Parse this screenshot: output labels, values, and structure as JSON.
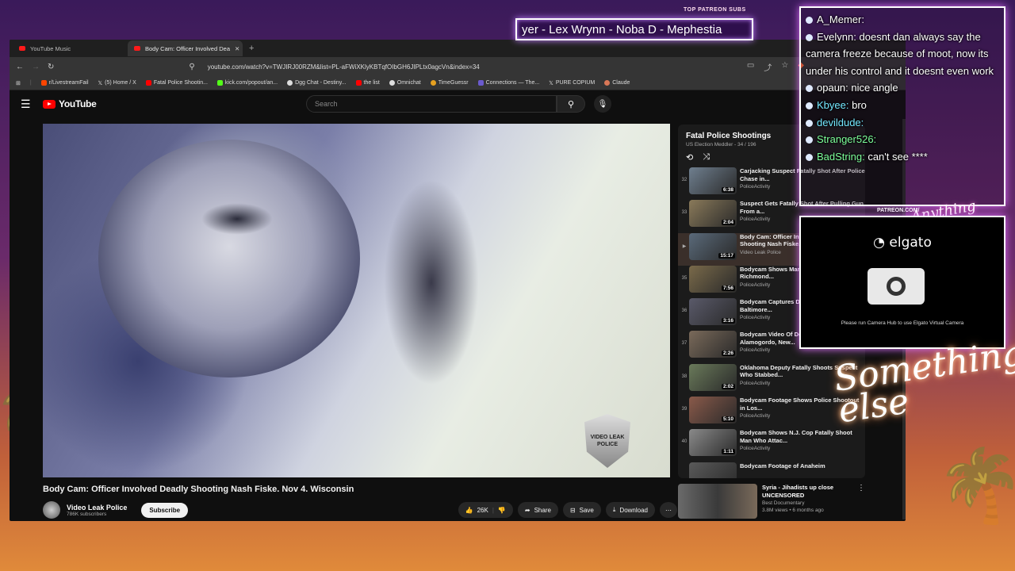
{
  "browser": {
    "tabs": [
      {
        "label": "YouTube Music",
        "active": false
      },
      {
        "label": "Body Cam: Officer Involved Dea",
        "active": true
      }
    ],
    "url": "youtube.com/watch?v=TWJIRJ00RZM&list=PL-aFWiXKlyKBTqfOIbGH6JIPLtx0agcVn&index=34",
    "bookmarks": [
      "r/LivestreamFail",
      "(5) Home / X",
      "Fatal Police Shootin...",
      "kick.com/popout/an...",
      "Dgg Chat - Destiny...",
      "the list",
      "Omnichat",
      "TimeGuessr",
      "Connections — The...",
      "PURE COPIUM",
      "Claude"
    ]
  },
  "youtube": {
    "logo": "YouTube",
    "search_placeholder": "Search",
    "video_title": "Body Cam: Officer Involved Deadly Shooting Nash Fiske. Nov 4. Wisconsin",
    "watermark": "VIDEO LEAK POLICE",
    "channel": {
      "name": "Video Leak Police",
      "subscribers": "786K subscribers"
    },
    "subscribe_label": "Subscribe",
    "actions": {
      "likes": "26K",
      "share": "Share",
      "save": "Save",
      "download": "Download"
    },
    "playlist": {
      "title": "Fatal Police Shootings",
      "subtitle": "US Election Meddler - 34 / 196",
      "items": [
        {
          "num": "32",
          "title": "Carjacking Suspect Fatally Shot After Police Chase in...",
          "channel": "PoliceActivity",
          "duration": "6:38",
          "color": "#6f7f8f"
        },
        {
          "num": "33",
          "title": "Suspect Gets Fatally Shot After Pulling Gun From a...",
          "channel": "PoliceActivity",
          "duration": "2:04",
          "color": "#8a7a5a"
        },
        {
          "num": "▶",
          "title": "Body Cam: Officer Involved Deadly Shooting Nash Fiske...",
          "channel": "Video Leak Police",
          "duration": "15:17",
          "color": "#5a6a7a"
        },
        {
          "num": "35",
          "title": "Bodycam Shows Man Being Fatally Shot by Richmond...",
          "channel": "PoliceActivity",
          "duration": "7:56",
          "color": "#7a6a4a"
        },
        {
          "num": "36",
          "title": "Bodycam Captures Deadly Shootout in Baltimore...",
          "channel": "PoliceActivity",
          "duration": "3:16",
          "color": "#5a5a6a"
        },
        {
          "num": "37",
          "title": "Bodycam Video Of Deadly Shootout in Alamogordo, New...",
          "channel": "PoliceActivity",
          "duration": "2:26",
          "color": "#7a6a5a"
        },
        {
          "num": "38",
          "title": "Oklahoma Deputy Fatally Shoots Suspect Who Stabbed...",
          "channel": "PoliceActivity",
          "duration": "2:02",
          "color": "#6a7a5a"
        },
        {
          "num": "39",
          "title": "Bodycam Footage Shows Police Shootout in Los...",
          "channel": "PoliceActivity",
          "duration": "5:10",
          "color": "#8a5a4a"
        },
        {
          "num": "40",
          "title": "Bodycam Shows N.J. Cop Fatally Shoot Man Who Attac...",
          "channel": "PoliceActivity",
          "duration": "1:11",
          "color": "#8a8a8a"
        },
        {
          "num": "",
          "title": "Bodycam Footage of Anaheim",
          "channel": "",
          "duration": "",
          "color": "#5a5a5a"
        }
      ]
    },
    "recommended": {
      "title": "Syria - Jihadists up close UNCENSORED",
      "channel": "Best Documentary",
      "meta": "3.8M views • 6 months ago"
    }
  },
  "overlay": {
    "subs_label": "TOP PATREON SUBS",
    "marquee": "yer - Lex Wrynn -  Noba D - Mephestia",
    "chat": [
      {
        "user": "A_Memer:",
        "msg": "",
        "cls": ""
      },
      {
        "user": "Evelynn:",
        "msg": "doesnt dan always say the camera freeze because of moot, now its under his control and it doesnt even work",
        "cls": ""
      },
      {
        "user": "opaun:",
        "msg": "nice angle",
        "cls": ""
      },
      {
        "user": "Kbyee:",
        "msg": "bro",
        "cls": "u-cyan"
      },
      {
        "user": "devildude:",
        "msg": "",
        "cls": "u-cyan"
      },
      {
        "user": "Stranger526:",
        "msg": "",
        "cls": "u-green"
      },
      {
        "user": "BadString:",
        "msg": "can't see ****",
        "cls": "u-green"
      }
    ],
    "patreon_url": "PATREON.COM/",
    "cam_brand": "elgato",
    "cam_message": "Please run Camera Hub to use Elgato Virtual Camera",
    "neon_small": "Anything Else?",
    "neon_script": "Something else"
  }
}
